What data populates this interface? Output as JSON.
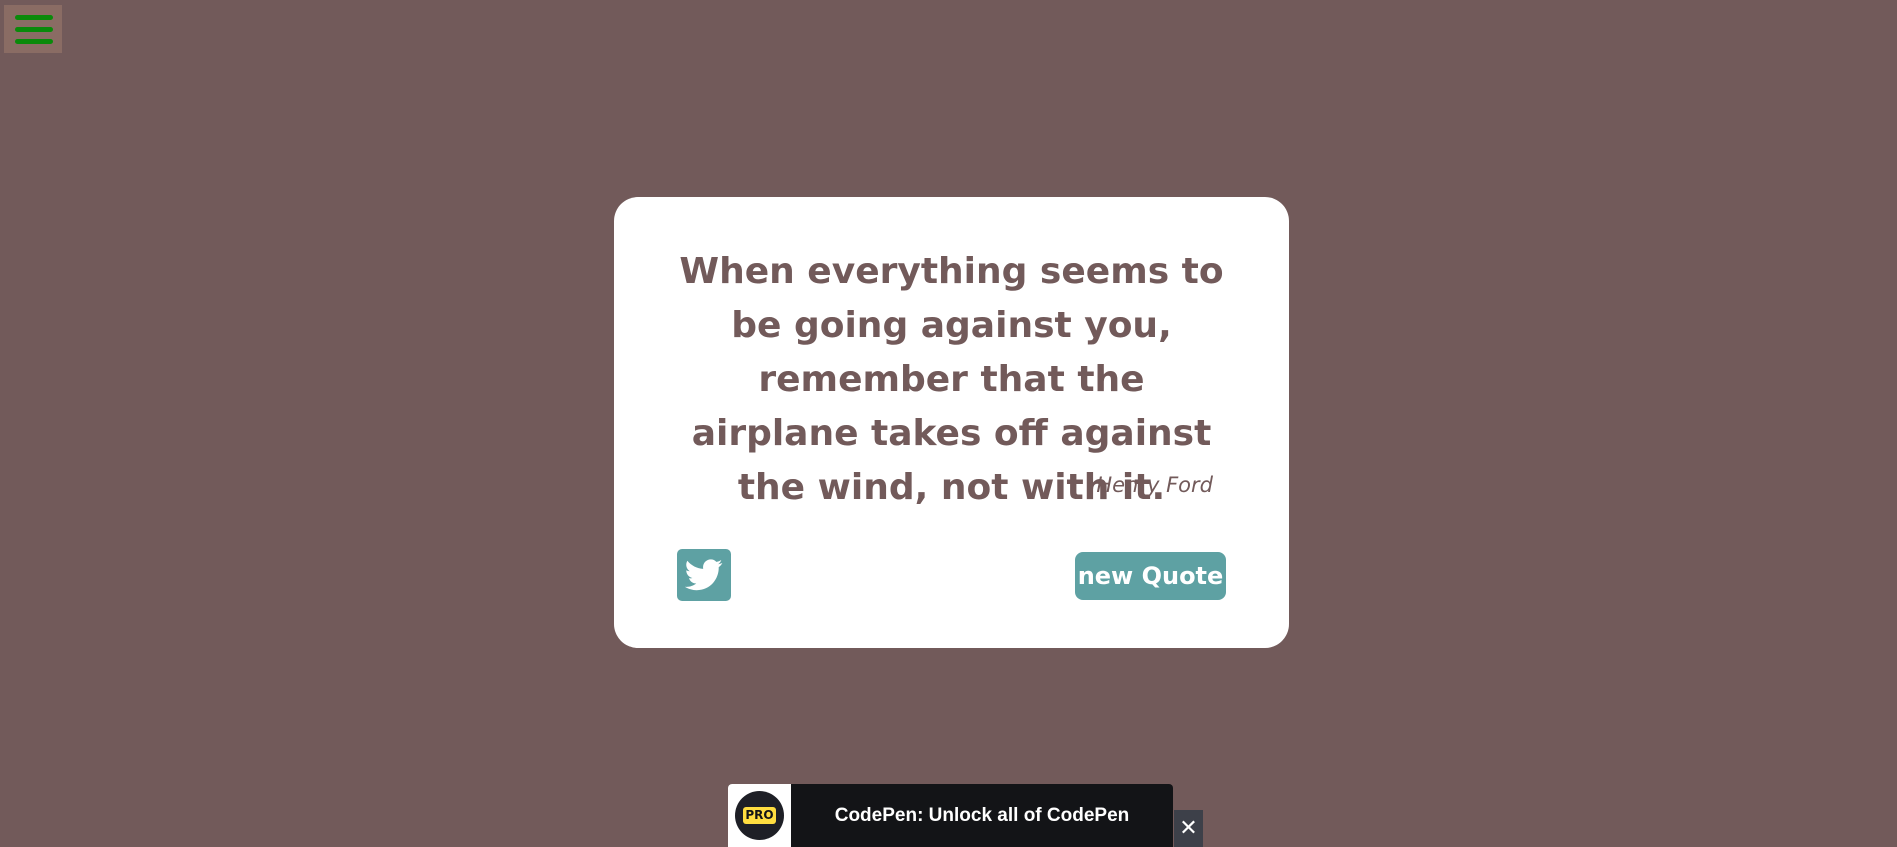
{
  "colors": {
    "background": "#725a5a",
    "card": "#ffffff",
    "text": "#725a5a",
    "button": "#5ea1a3",
    "menu_bars": "#0a8a0a"
  },
  "menu": {
    "icon": "hamburger-menu-icon"
  },
  "quote": {
    "text": "When everything seems to be going against you, remember that the airplane takes off against the wind, not with it.",
    "author": "Henry Ford"
  },
  "actions": {
    "tweet_icon": "twitter-bird-icon",
    "new_quote_label": "new Quote"
  },
  "promo": {
    "badge": "PRO",
    "text": "CodePen: Unlock all of CodePen",
    "close_glyph": "✕"
  }
}
